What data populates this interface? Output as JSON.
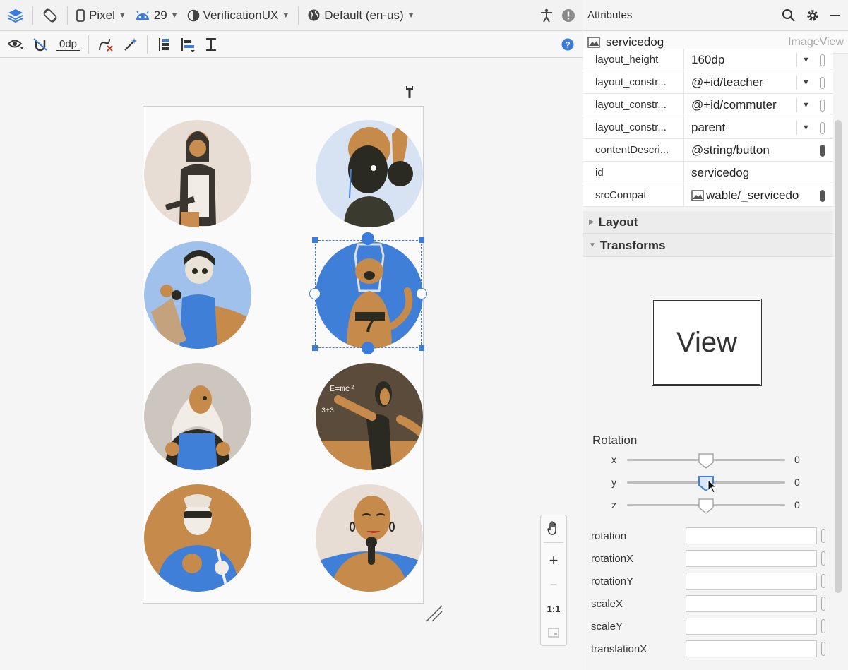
{
  "toolbar": {
    "device": "Pixel",
    "api_level": "29",
    "theme": "VerificationUX",
    "locale": "Default (en-us)",
    "default_margin": "0dp"
  },
  "panel": {
    "title": "Attributes",
    "component_name": "servicedog",
    "component_type": "ImageView",
    "attributes": [
      {
        "name": "layout_height",
        "value": "160dp",
        "dropdown": true,
        "pill": "empty"
      },
      {
        "name": "layout_constr...",
        "value": "@+id/teacher",
        "dropdown": true,
        "pill": "empty"
      },
      {
        "name": "layout_constr...",
        "value": "@+id/commuter",
        "dropdown": true,
        "pill": "empty"
      },
      {
        "name": "layout_constr...",
        "value": "parent",
        "dropdown": true,
        "pill": "empty"
      },
      {
        "name": "contentDescri...",
        "value": "@string/button",
        "dropdown": false,
        "pill": "filled"
      },
      {
        "name": "id",
        "value": "servicedog",
        "dropdown": false,
        "pill": "none"
      },
      {
        "name": "srcCompat",
        "value": "wable/_servicedo",
        "dropdown": false,
        "pill": "filled",
        "icon": "image-icon"
      }
    ],
    "sections": {
      "layout": "Layout",
      "transforms": "Transforms"
    },
    "view_preview": "View",
    "rotation": {
      "label": "Rotation",
      "axes": [
        {
          "axis": "x",
          "value": "0"
        },
        {
          "axis": "y",
          "value": "0"
        },
        {
          "axis": "z",
          "value": "0"
        }
      ]
    },
    "transform_fields": [
      "rotation",
      "rotationX",
      "rotationY",
      "scaleX",
      "scaleY",
      "translationX"
    ]
  },
  "zoom": {
    "zoom_in": "+",
    "zoom_out": "−",
    "actual_size": "1:1"
  },
  "colors": {
    "accent": "#3a7dde",
    "ochre": "#c68a4a",
    "blue": "#3f7fd8",
    "dark": "#2e2e2a"
  }
}
